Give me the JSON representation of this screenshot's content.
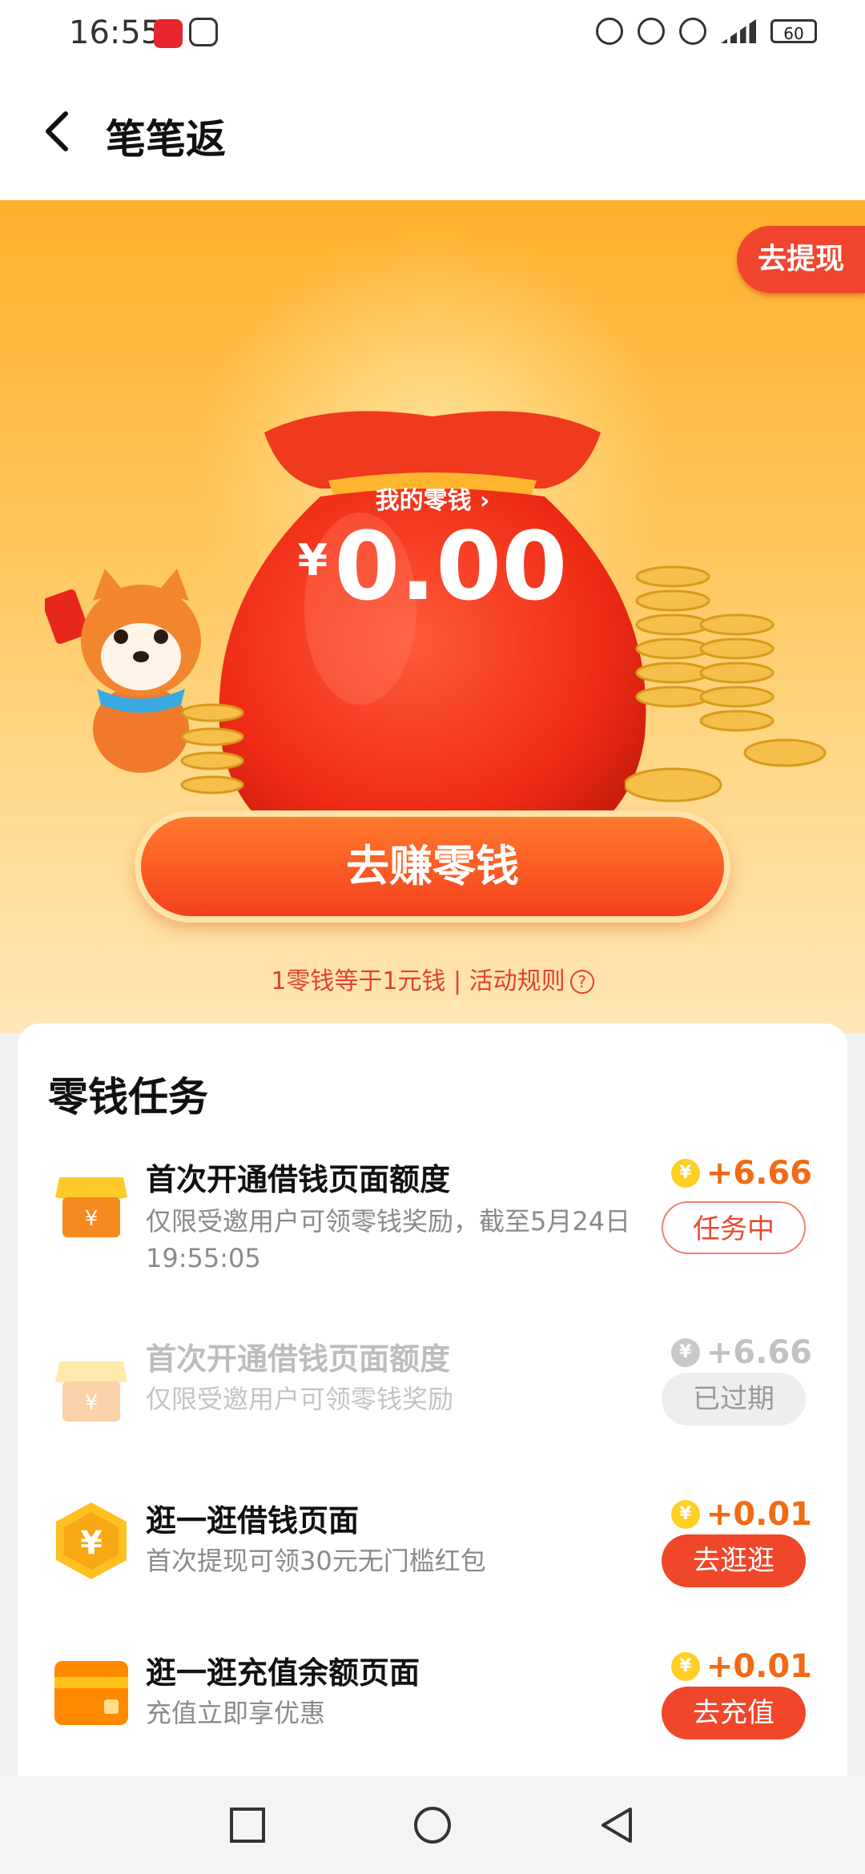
{
  "status_bar": {
    "time": "16:55",
    "battery": "60"
  },
  "header": {
    "title": "笔笔返"
  },
  "hero": {
    "withdraw_label": "去提现",
    "wallet_label": "我的零钱 ›",
    "currency_symbol": "¥",
    "amount": "0.00",
    "earn_button": "去赚零钱",
    "rule_text": "1零钱等于1元钱 | 活动规则",
    "rule_icon": "?"
  },
  "tasks_section": {
    "title": "零钱任务",
    "tasks": [
      {
        "name": "首次开通借钱页面额度",
        "desc": "仅限受邀用户可领零钱奖励，截至5月24日19:55:05",
        "reward": "+6.66",
        "button": "任务中",
        "state": "ongoing",
        "icon": "shop-icon"
      },
      {
        "name": "首次开通借钱页面额度",
        "desc": "仅限受邀用户可领零钱奖励",
        "reward": "+6.66",
        "button": "已过期",
        "state": "expired",
        "icon": "shop-icon"
      },
      {
        "name": "逛一逛借钱页面",
        "desc": "首次提现可领30元无门槛红包",
        "reward": "+0.01",
        "button": "去逛逛",
        "state": "go",
        "icon": "yen-hexagon-icon"
      },
      {
        "name": "逛一逛充值余额页面",
        "desc": "充值立即享优惠",
        "reward": "+0.01",
        "button": "去充值",
        "state": "go",
        "icon": "card-icon"
      }
    ]
  },
  "coin_symbol": "¥",
  "colors": {
    "accent": "#f0472a",
    "reward": "#f26a12",
    "hero_top": "#ffb02b"
  }
}
